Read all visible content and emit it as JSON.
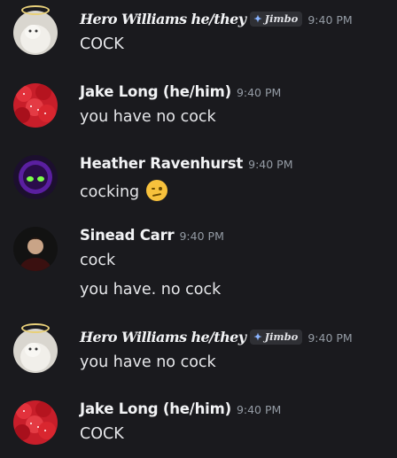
{
  "messages": [
    {
      "author": "Hero Williams he/they",
      "tag": "Jimbo",
      "time": "9:40 PM",
      "lines": [
        "COCK"
      ],
      "avatar": "angel-cat-avatar"
    },
    {
      "author": "Jake Long (he/him)",
      "time": "9:40 PM",
      "lines": [
        "you have no cock"
      ],
      "avatar": "strawberries-avatar"
    },
    {
      "author": "Heather Ravenhurst",
      "time": "9:40 PM",
      "lines": [
        "cocking"
      ],
      "emoji": "face-with-raised-eyebrow",
      "avatar": "purple-creature-avatar"
    },
    {
      "author": "Sinead Carr",
      "time": "9:40 PM",
      "lines": [
        "cock",
        "you have. no cock"
      ],
      "avatar": "person-photo-avatar"
    },
    {
      "author": "Hero Williams he/they",
      "tag": "Jimbo",
      "time": "9:40 PM",
      "lines": [
        "you have no cock"
      ],
      "avatar": "angel-cat-avatar"
    },
    {
      "author": "Jake Long (he/him)",
      "time": "9:40 PM",
      "lines": [
        "COCK"
      ],
      "avatar": "strawberries-avatar"
    }
  ],
  "colors": {
    "background": "#1a1a1e",
    "name": "#f2f3f5",
    "timestamp": "#949ba4",
    "text": "#e6e7ea"
  }
}
